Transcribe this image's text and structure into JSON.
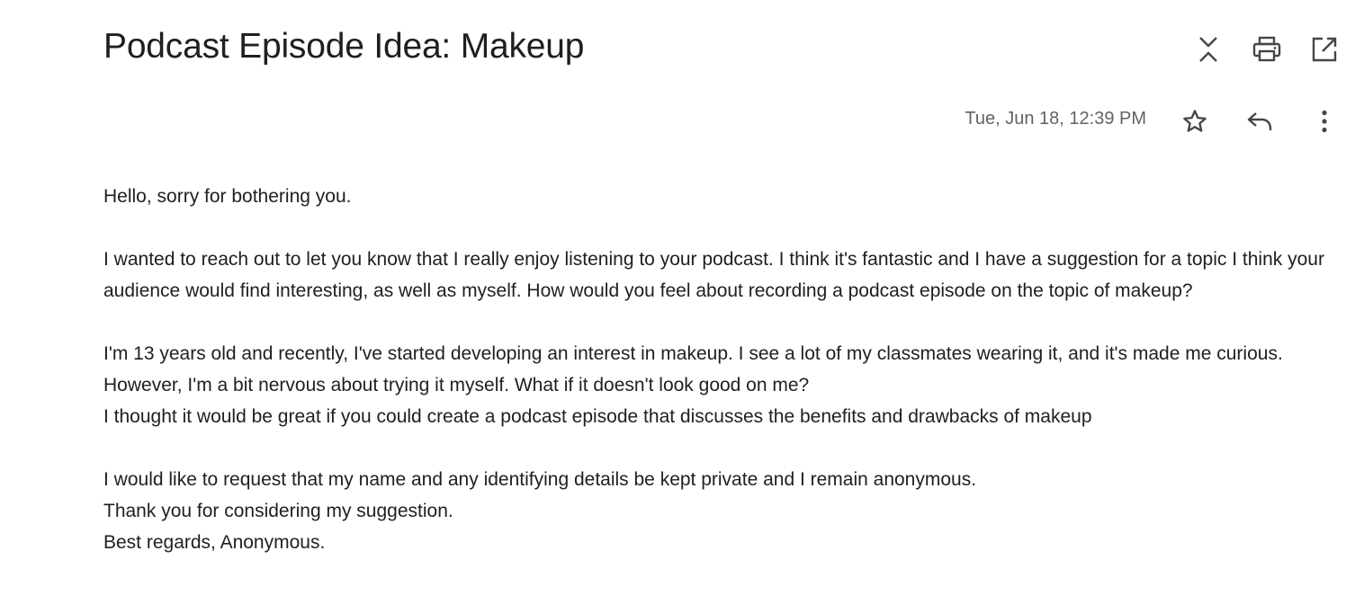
{
  "email": {
    "subject": "Podcast Episode Idea: Makeup",
    "date": "Tue, Jun 18, 12:39 PM",
    "body": {
      "greeting": "Hello, sorry for bothering you.",
      "paragraph1": "I wanted to reach out to let you know that I really enjoy listening to your podcast. I think it's fantastic and I have a suggestion for a topic I think your audience would find interesting, as well as myself. How would you feel about recording a podcast episode on the topic of makeup?",
      "paragraph2_line1": "I'm 13 years old and recently, I've started developing an interest in makeup. I see a lot of my classmates wearing it, and it's made me curious. However, I'm a bit nervous about trying it myself. What if it doesn't look good on me?",
      "paragraph2_line2": "I thought it would be great if you could create a podcast episode that discusses the benefits and drawbacks of makeup",
      "closing_line1": "I would like to request that my name and any identifying details be kept private and I remain anonymous.",
      "closing_line2": "Thank you for considering my suggestion.",
      "closing_line3": "Best regards, Anonymous."
    }
  },
  "toolbar": {
    "icons": [
      "collapse-all-icon",
      "print-icon",
      "open-in-new-window-icon"
    ]
  },
  "message_actions": {
    "icons": [
      "star-icon",
      "reply-icon",
      "more-options-icon"
    ]
  },
  "colors": {
    "text": "#1f1f1f",
    "muted": "#5f6368",
    "icon": "#444746"
  }
}
